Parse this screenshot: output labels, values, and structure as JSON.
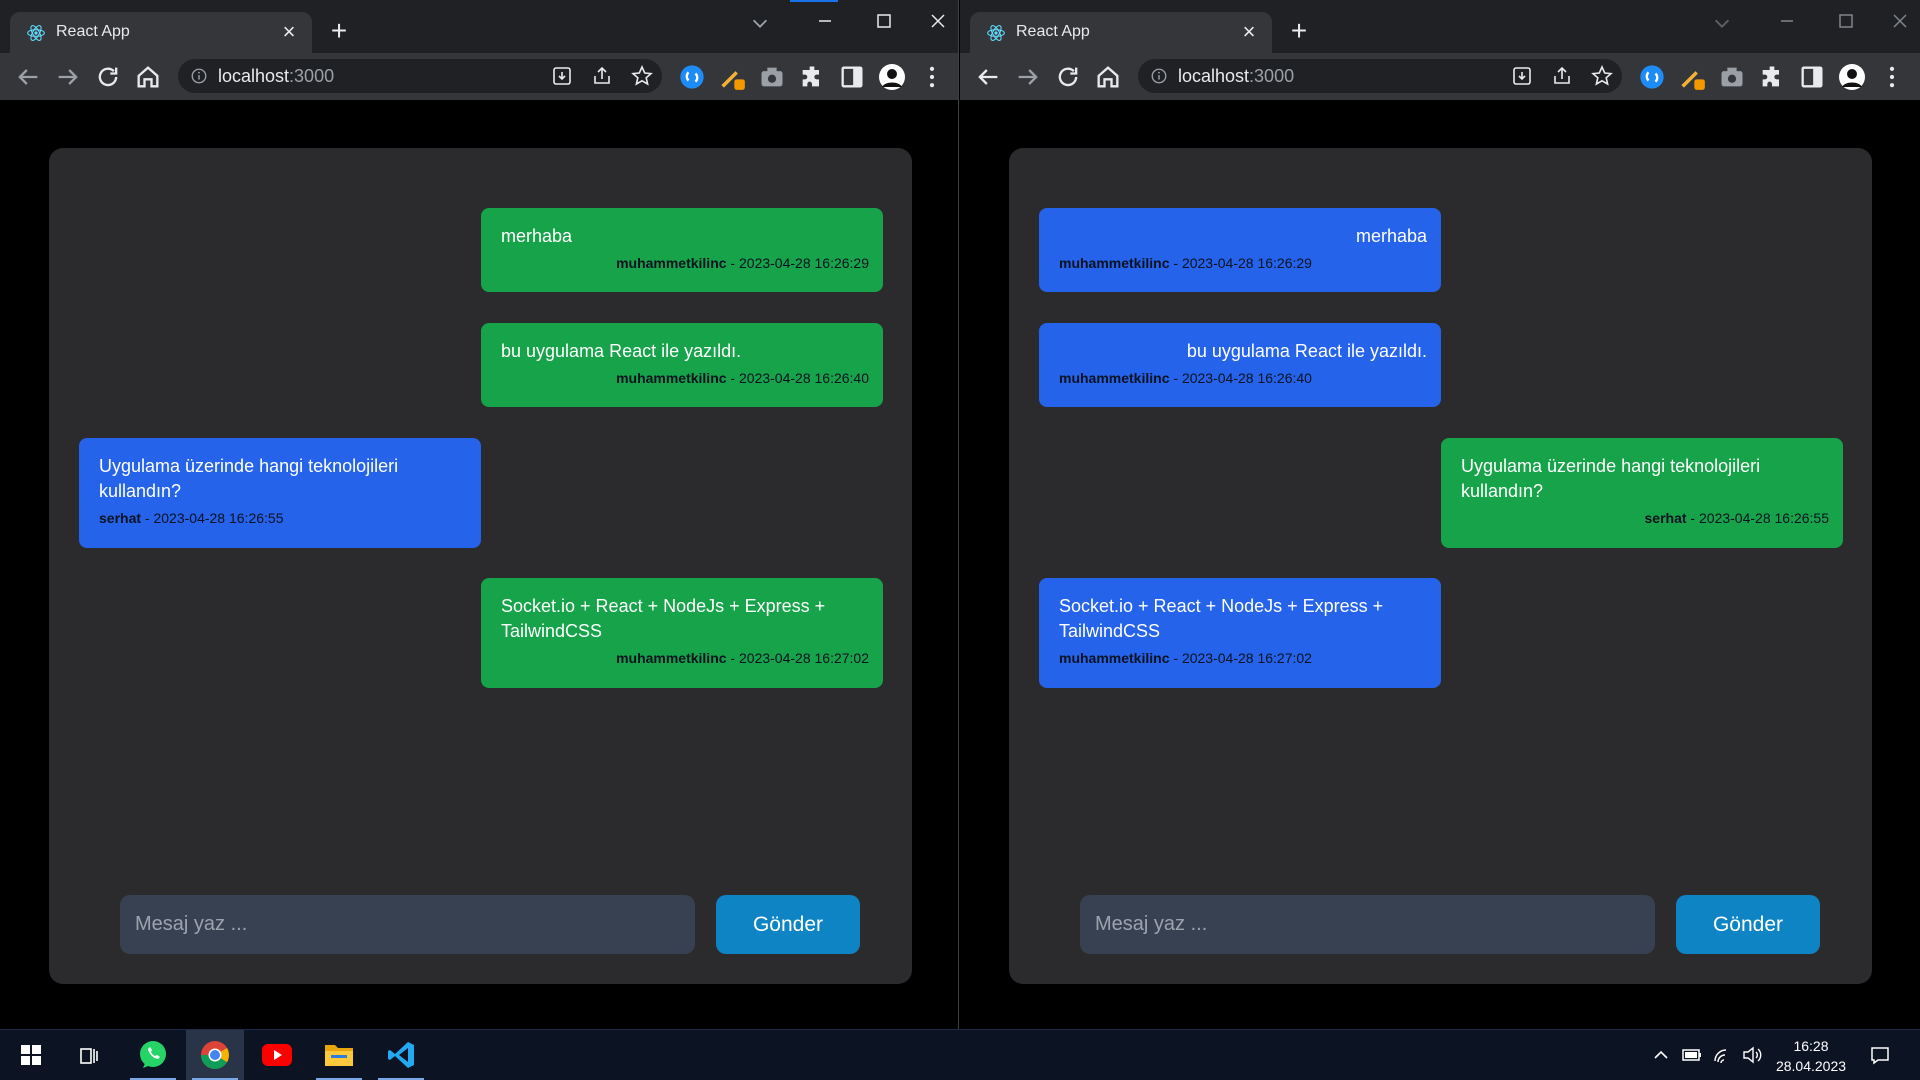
{
  "windows": [
    {
      "tab_title": "React App",
      "url_host": "localhost",
      "url_port": ":3000",
      "messages": [
        {
          "text": "merhaba",
          "author": "muhammetkilinc",
          "time": "2023-04-28 16:26:29",
          "color": "green",
          "side": "right"
        },
        {
          "text": "bu uygulama React ile yazıldı.",
          "author": "muhammetkilinc",
          "time": "2023-04-28 16:26:40",
          "color": "green",
          "side": "right"
        },
        {
          "text": "Uygulama üzerinde hangi teknolojileri kullandın?",
          "author": "serhat",
          "time": "2023-04-28 16:26:55",
          "color": "blue",
          "side": "left"
        },
        {
          "text": "Socket.io + React + NodeJs + Express + TailwindCSS",
          "author": "muhammetkilinc",
          "time": "2023-04-28 16:27:02",
          "color": "green",
          "side": "right"
        }
      ],
      "composer": {
        "placeholder": "Mesaj yaz ...",
        "value": "",
        "send_label": "Gönder"
      }
    },
    {
      "tab_title": "React App",
      "url_host": "localhost",
      "url_port": ":3000",
      "messages": [
        {
          "text": "merhaba",
          "author": "muhammetkilinc",
          "time": "2023-04-28 16:26:29",
          "color": "blue",
          "side": "left"
        },
        {
          "text": "bu uygulama React ile yazıldı.",
          "author": "muhammetkilinc",
          "time": "2023-04-28 16:26:40",
          "color": "blue",
          "side": "left"
        },
        {
          "text": "Uygulama üzerinde hangi teknolojileri kullandın?",
          "author": "serhat",
          "time": "2023-04-28 16:26:55",
          "color": "green",
          "side": "right"
        },
        {
          "text": "Socket.io + React + NodeJs + Express + TailwindCSS",
          "author": "muhammetkilinc",
          "time": "2023-04-28 16:27:02",
          "color": "blue",
          "side": "left"
        }
      ],
      "composer": {
        "placeholder": "Mesaj yaz ...",
        "value": "",
        "send_label": "Gönder"
      }
    }
  ],
  "taskbar": {
    "apps": [
      "windows-start",
      "task-view",
      "whatsapp",
      "chrome",
      "youtube",
      "file-explorer",
      "vscode"
    ],
    "active_app": "chrome",
    "clock": {
      "time": "16:28",
      "date": "28.04.2023"
    }
  },
  "colors": {
    "green_bubble": "#16a34a",
    "blue_bubble": "#2563eb",
    "panel": "#2b2b2d",
    "send_button": "#0f84c4",
    "input_bg": "#374151"
  }
}
